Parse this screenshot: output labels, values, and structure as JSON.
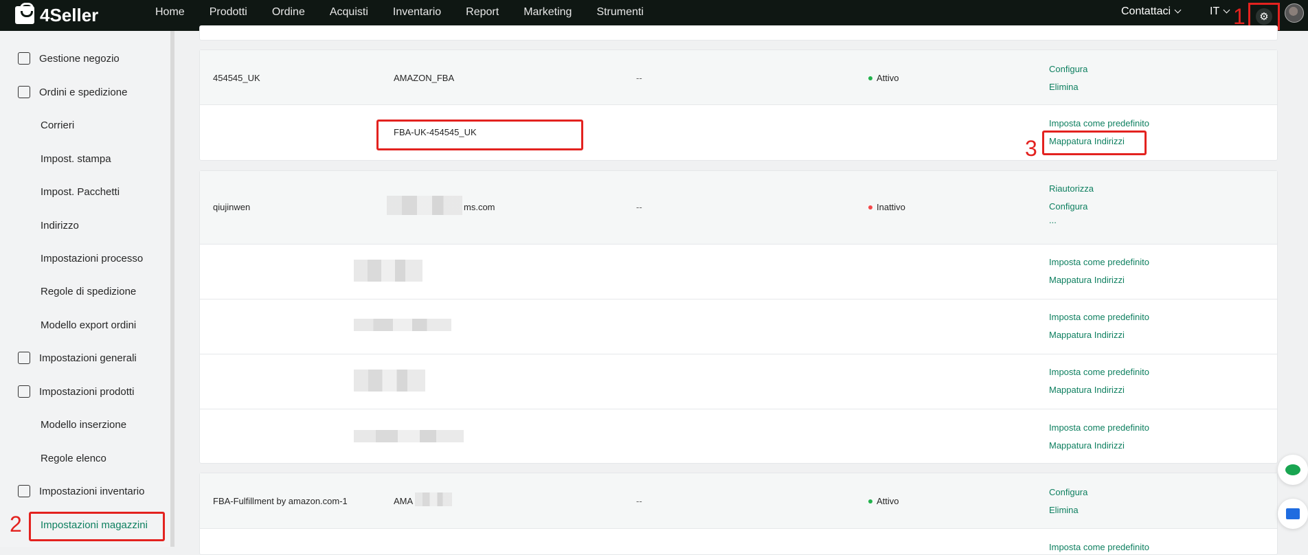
{
  "app": {
    "brand": "4Seller"
  },
  "topnav": [
    "Home",
    "Prodotti",
    "Ordine",
    "Acquisti",
    "Inventario",
    "Report",
    "Marketing",
    "Strumenti"
  ],
  "header_right": {
    "contact": "Contattaci",
    "lang": "IT"
  },
  "annotations": {
    "a1": "1",
    "a2": "2",
    "a3": "3"
  },
  "sidebar": {
    "items": [
      {
        "label": "Gestione negozio",
        "icon": "store-icon"
      },
      {
        "label": "Ordini e spedizione",
        "icon": "bag-icon"
      },
      {
        "label": "Corrieri"
      },
      {
        "label": "Impost. stampa"
      },
      {
        "label": "Impost. Pacchetti"
      },
      {
        "label": "Indirizzo"
      },
      {
        "label": "Impostazioni processo"
      },
      {
        "label": "Regole di spedizione"
      },
      {
        "label": "Modello export ordini"
      },
      {
        "label": "Impostazioni generali",
        "icon": "printer-icon"
      },
      {
        "label": "Impostazioni prodotti",
        "icon": "upload-box-icon"
      },
      {
        "label": "Modello inserzione"
      },
      {
        "label": "Regole elenco"
      },
      {
        "label": "Impostazioni inventario",
        "icon": "warehouse-icon"
      },
      {
        "label": "Impostazioni magazzini",
        "active": true
      }
    ]
  },
  "stores": [
    {
      "name": "454545_UK",
      "platform": "AMAZON_FBA",
      "col3": "--",
      "status": "Attivo",
      "status_color": "#22b24c",
      "actions": [
        "Configura",
        "Elimina"
      ],
      "warehouses": [
        {
          "name": "FBA-UK-454545_UK",
          "actions": [
            "Imposta come predefinito",
            "Mappatura Indirizzi"
          ]
        }
      ]
    },
    {
      "name": "qiujinwen",
      "platform": "ms.com",
      "col3": "--",
      "status": "Inattivo",
      "status_color": "#f5484a",
      "actions": [
        "Riautorizza",
        "Configura",
        "..."
      ],
      "warehouses": [
        {
          "name": "",
          "actions": [
            "Imposta come predefinito",
            "Mappatura Indirizzi"
          ]
        },
        {
          "name": "",
          "actions": [
            "Imposta come predefinito",
            "Mappatura Indirizzi"
          ]
        },
        {
          "name": "",
          "actions": [
            "Imposta come predefinito",
            "Mappatura Indirizzi"
          ]
        },
        {
          "name": "",
          "actions": [
            "Imposta come predefinito",
            "Mappatura Indirizzi"
          ]
        }
      ]
    },
    {
      "name": "FBA-Fulfillment by amazon.com-1",
      "platform": "AMA",
      "col3": "--",
      "status": "Attivo",
      "status_color": "#22b24c",
      "actions": [
        "Configura",
        "Elimina"
      ],
      "warehouses": [
        {
          "name": "",
          "actions": [
            "Imposta come predefinito"
          ]
        }
      ]
    }
  ],
  "colors": {
    "accent": "#0d7f5f",
    "highlight": "#e3221f",
    "topbar": "#0f1713"
  }
}
